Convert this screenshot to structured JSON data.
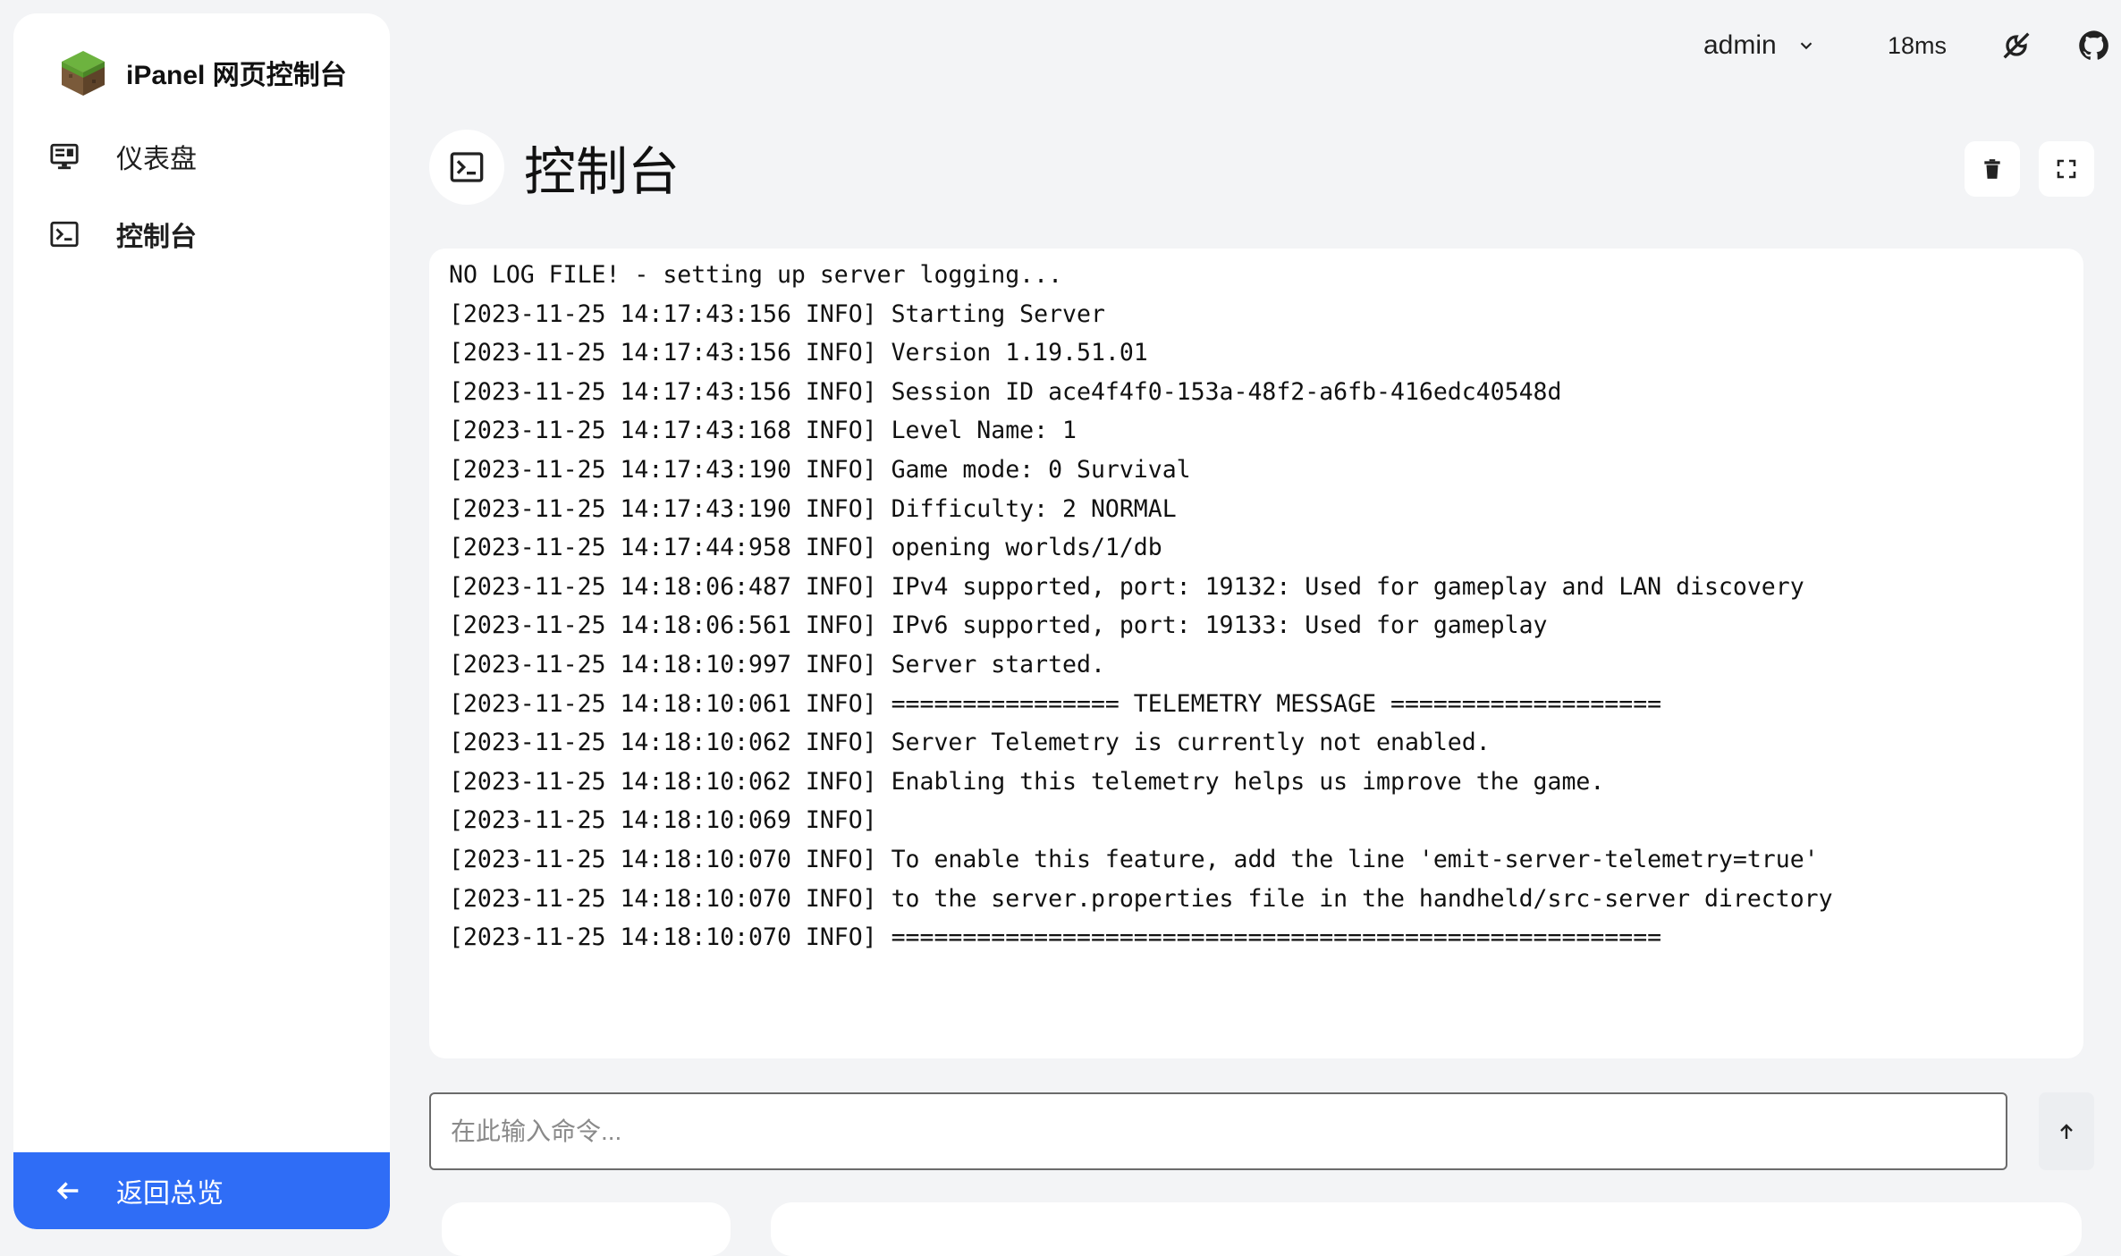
{
  "brand": {
    "title": "iPanel 网页控制台"
  },
  "sidebar": {
    "items": [
      {
        "label": "仪表盘",
        "icon": "monitor-icon",
        "active": false
      },
      {
        "label": "控制台",
        "icon": "terminal-icon",
        "active": true
      }
    ],
    "back": {
      "label": "返回总览",
      "icon": "arrow-left-icon"
    }
  },
  "topbar": {
    "user": "admin",
    "latency": "18ms",
    "icons": [
      "theme-toggle-icon",
      "github-icon"
    ]
  },
  "page": {
    "title": "控制台",
    "icon": "terminal-icon"
  },
  "actions": {
    "clear_icon": "trash-icon",
    "fullscreen_icon": "fullscreen-icon"
  },
  "console": {
    "lines": [
      "NO LOG FILE! - setting up server logging...",
      "[2023-11-25 14:17:43:156 INFO] Starting Server",
      "[2023-11-25 14:17:43:156 INFO] Version 1.19.51.01",
      "[2023-11-25 14:17:43:156 INFO] Session ID ace4f4f0-153a-48f2-a6fb-416edc40548d",
      "[2023-11-25 14:17:43:168 INFO] Level Name: 1",
      "[2023-11-25 14:17:43:190 INFO] Game mode: 0 Survival",
      "[2023-11-25 14:17:43:190 INFO] Difficulty: 2 NORMAL",
      "[2023-11-25 14:17:44:958 INFO] opening worlds/1/db",
      "[2023-11-25 14:18:06:487 INFO] IPv4 supported, port: 19132: Used for gameplay and LAN discovery",
      "[2023-11-25 14:18:06:561 INFO] IPv6 supported, port: 19133: Used for gameplay",
      "[2023-11-25 14:18:10:997 INFO] Server started.",
      "[2023-11-25 14:18:10:061 INFO] ================ TELEMETRY MESSAGE ===================",
      "[2023-11-25 14:18:10:062 INFO] Server Telemetry is currently not enabled.",
      "[2023-11-25 14:18:10:062 INFO] Enabling this telemetry helps us improve the game.",
      "[2023-11-25 14:18:10:069 INFO]",
      "[2023-11-25 14:18:10:070 INFO] To enable this feature, add the line 'emit-server-telemetry=true'",
      "[2023-11-25 14:18:10:070 INFO] to the server.properties file in the handheld/src-server directory",
      "[2023-11-25 14:18:10:070 INFO] ======================================================"
    ]
  },
  "command": {
    "placeholder": "在此输入命令...",
    "value": "",
    "send_icon": "arrow-up-icon"
  },
  "colors": {
    "accent": "#2f6df6",
    "background": "#f3f4f6",
    "surface": "#ffffff"
  }
}
